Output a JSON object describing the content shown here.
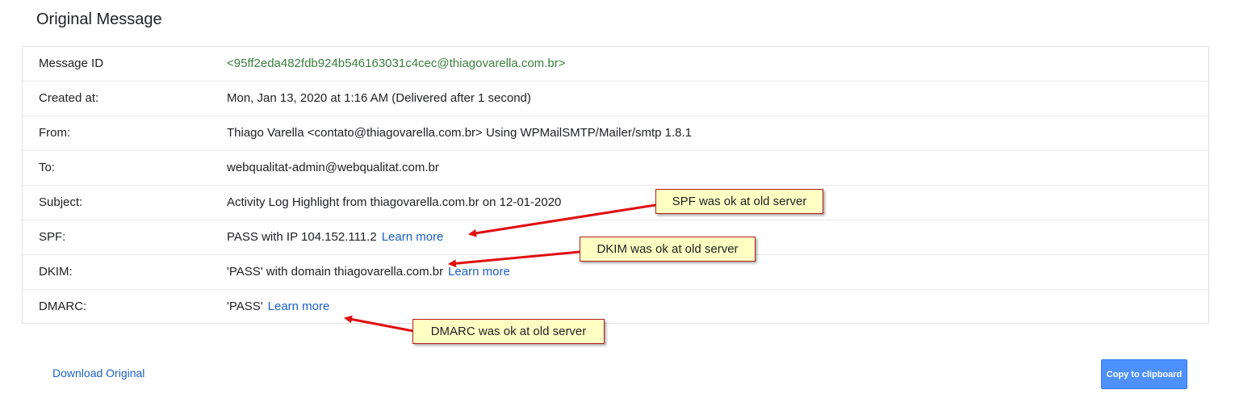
{
  "title": "Original Message",
  "rows": [
    {
      "label": "Message ID",
      "value": "<95ff2eda482fdb924b546163031c4cec@thiagovarella.com.br>"
    },
    {
      "label": "Created at:",
      "value": "Mon, Jan 13, 2020 at 1:16 AM (Delivered after 1 second)"
    },
    {
      "label": "From:",
      "value": "Thiago Varella <contato@thiagovarella.com.br> Using WPMailSMTP/Mailer/smtp 1.8.1"
    },
    {
      "label": "To:",
      "value": "webqualitat-admin@webqualitat.com.br"
    },
    {
      "label": "Subject:",
      "value": "Activity Log Highlight from thiagovarella.com.br on 12-01-2020"
    },
    {
      "label": "SPF:",
      "value": "PASS with IP 104.152.111.2",
      "link": "Learn more"
    },
    {
      "label": "DKIM:",
      "value": "'PASS' with domain thiagovarella.com.br",
      "link": "Learn more"
    },
    {
      "label": "DMARC:",
      "value": "'PASS'",
      "link": "Learn more"
    }
  ],
  "footer": {
    "download_label": "Download Original",
    "copy_label": "Copy to clipboard"
  },
  "annotations": {
    "spf_note": "SPF was ok at old server",
    "dkim_note": "DKIM was ok at old server",
    "dmarc_note": "DMARC was ok at old server",
    "arrow_color": "#e01010",
    "note_background": "#ffffc4"
  },
  "colors": {
    "message_id": "#3a7f3e",
    "link": "#1a5fc4",
    "button": "#4d90fe"
  }
}
